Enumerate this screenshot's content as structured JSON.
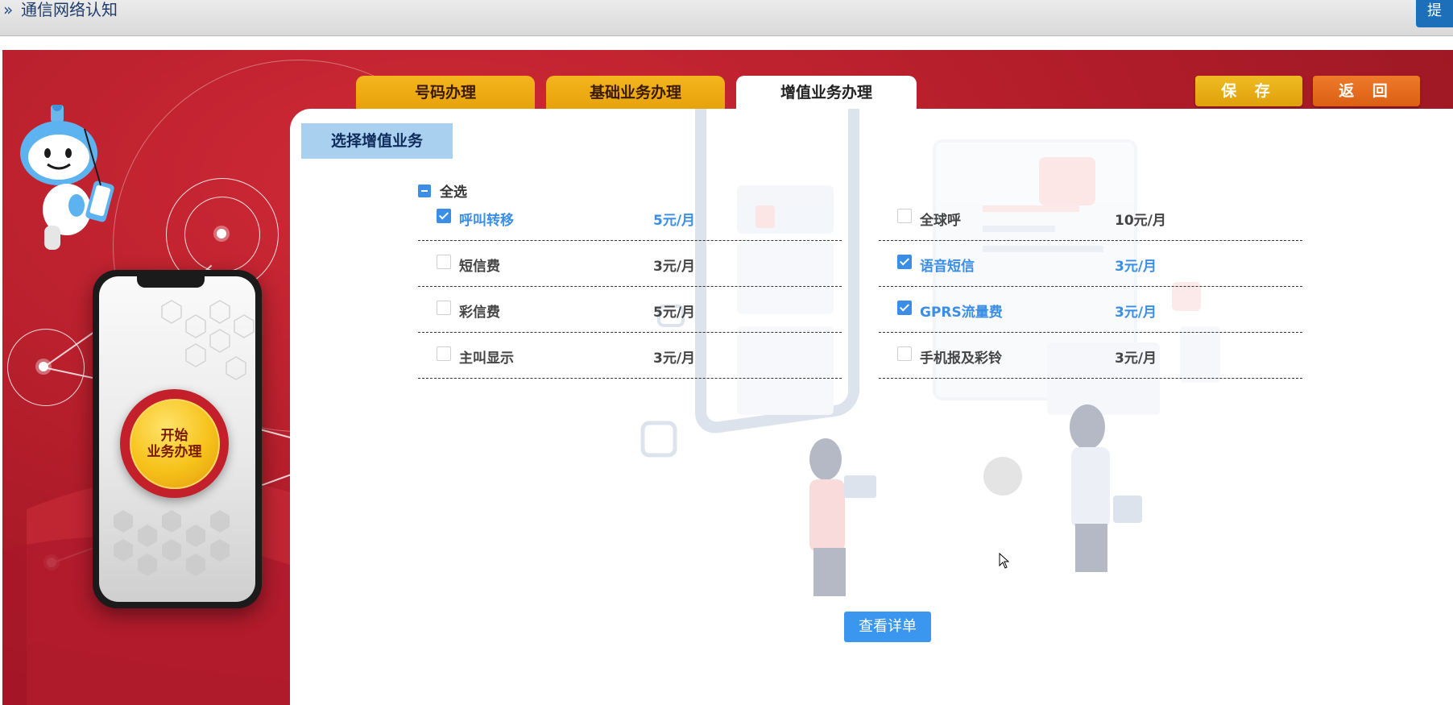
{
  "header": {
    "title": "通信网络认知",
    "corner_button": "提"
  },
  "tabs": [
    {
      "label": "号码办理",
      "active": false
    },
    {
      "label": "基础业务办理",
      "active": false
    },
    {
      "label": "增值业务办理",
      "active": true
    }
  ],
  "actions": {
    "save": "保 存",
    "back": "返 回"
  },
  "start_button": {
    "label": "开始\n业务办理"
  },
  "section": {
    "title": "选择增值业务"
  },
  "select_all": {
    "label": "全选",
    "state": "indeterminate"
  },
  "services": [
    {
      "name": "呼叫转移",
      "price": "5元/月",
      "checked": true
    },
    {
      "name": "全球呼",
      "price": "10元/月",
      "checked": false
    },
    {
      "name": "短信费",
      "price": "3元/月",
      "checked": false
    },
    {
      "name": "语音短信",
      "price": "3元/月",
      "checked": true
    },
    {
      "name": "彩信费",
      "price": "5元/月",
      "checked": false
    },
    {
      "name": "GPRS流量费",
      "price": "3元/月",
      "checked": true
    },
    {
      "name": "主叫显示",
      "price": "3元/月",
      "checked": false
    },
    {
      "name": "手机报及彩铃",
      "price": "3元/月",
      "checked": false
    }
  ],
  "detail_button": "查看详单",
  "colors": {
    "accent": "#3a8ee6",
    "tab_gold": "#f4b51e",
    "stage_red": "#b31d2a",
    "save": "#f0bb22",
    "back": "#ee7a2a"
  }
}
